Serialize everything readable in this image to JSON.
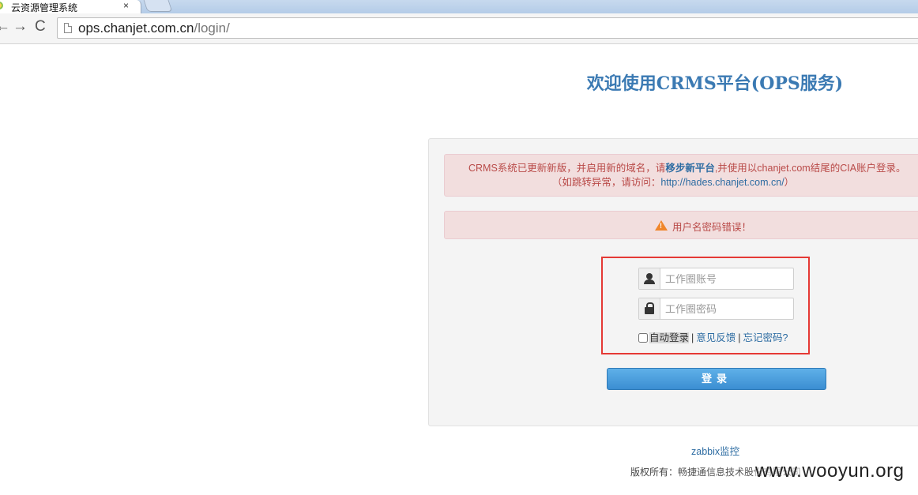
{
  "browser": {
    "tab_title": "云资源管理系统",
    "tab_close": "×",
    "back": "←",
    "forward": "→",
    "reload": "C",
    "url_host": "ops.chanjet.com.cn",
    "url_path": "/login/"
  },
  "page": {
    "title": "欢迎使用CRMS平台(OPS服务)",
    "notice": {
      "prefix": "CRMS系统已更新新版，并启用新的域名，请",
      "link": "移步新平台",
      "suffix": ",并使用以chanjet.com结尾的CIA账户登录。",
      "alt_prefix": "（如跳转异常，请访问：",
      "alt_url": "http://hades.chanjet.com.cn/",
      "alt_suffix": "）"
    },
    "error_message": "用户名密码错误！",
    "form": {
      "username_placeholder": "工作圈账号",
      "password_placeholder": "工作圈密码",
      "remember_label": "自动登录",
      "sep": "|",
      "feedback_link": "意见反馈",
      "forgot_link": "忘记密码?",
      "login_button": "登录"
    },
    "zabbix_link": "zabbix监控",
    "copyright_prefix": "版权所有：",
    "copyright_owner": "畅捷通信息技术股份有限公司",
    "watermark": "www.wooyun.org"
  },
  "colors": {
    "title": "#3b7ab3",
    "alert_bg": "#f2dede",
    "alert_text": "#b94a48",
    "link": "#2d6ca2",
    "button": "#3b8ed2",
    "highlight": "#e53935"
  }
}
